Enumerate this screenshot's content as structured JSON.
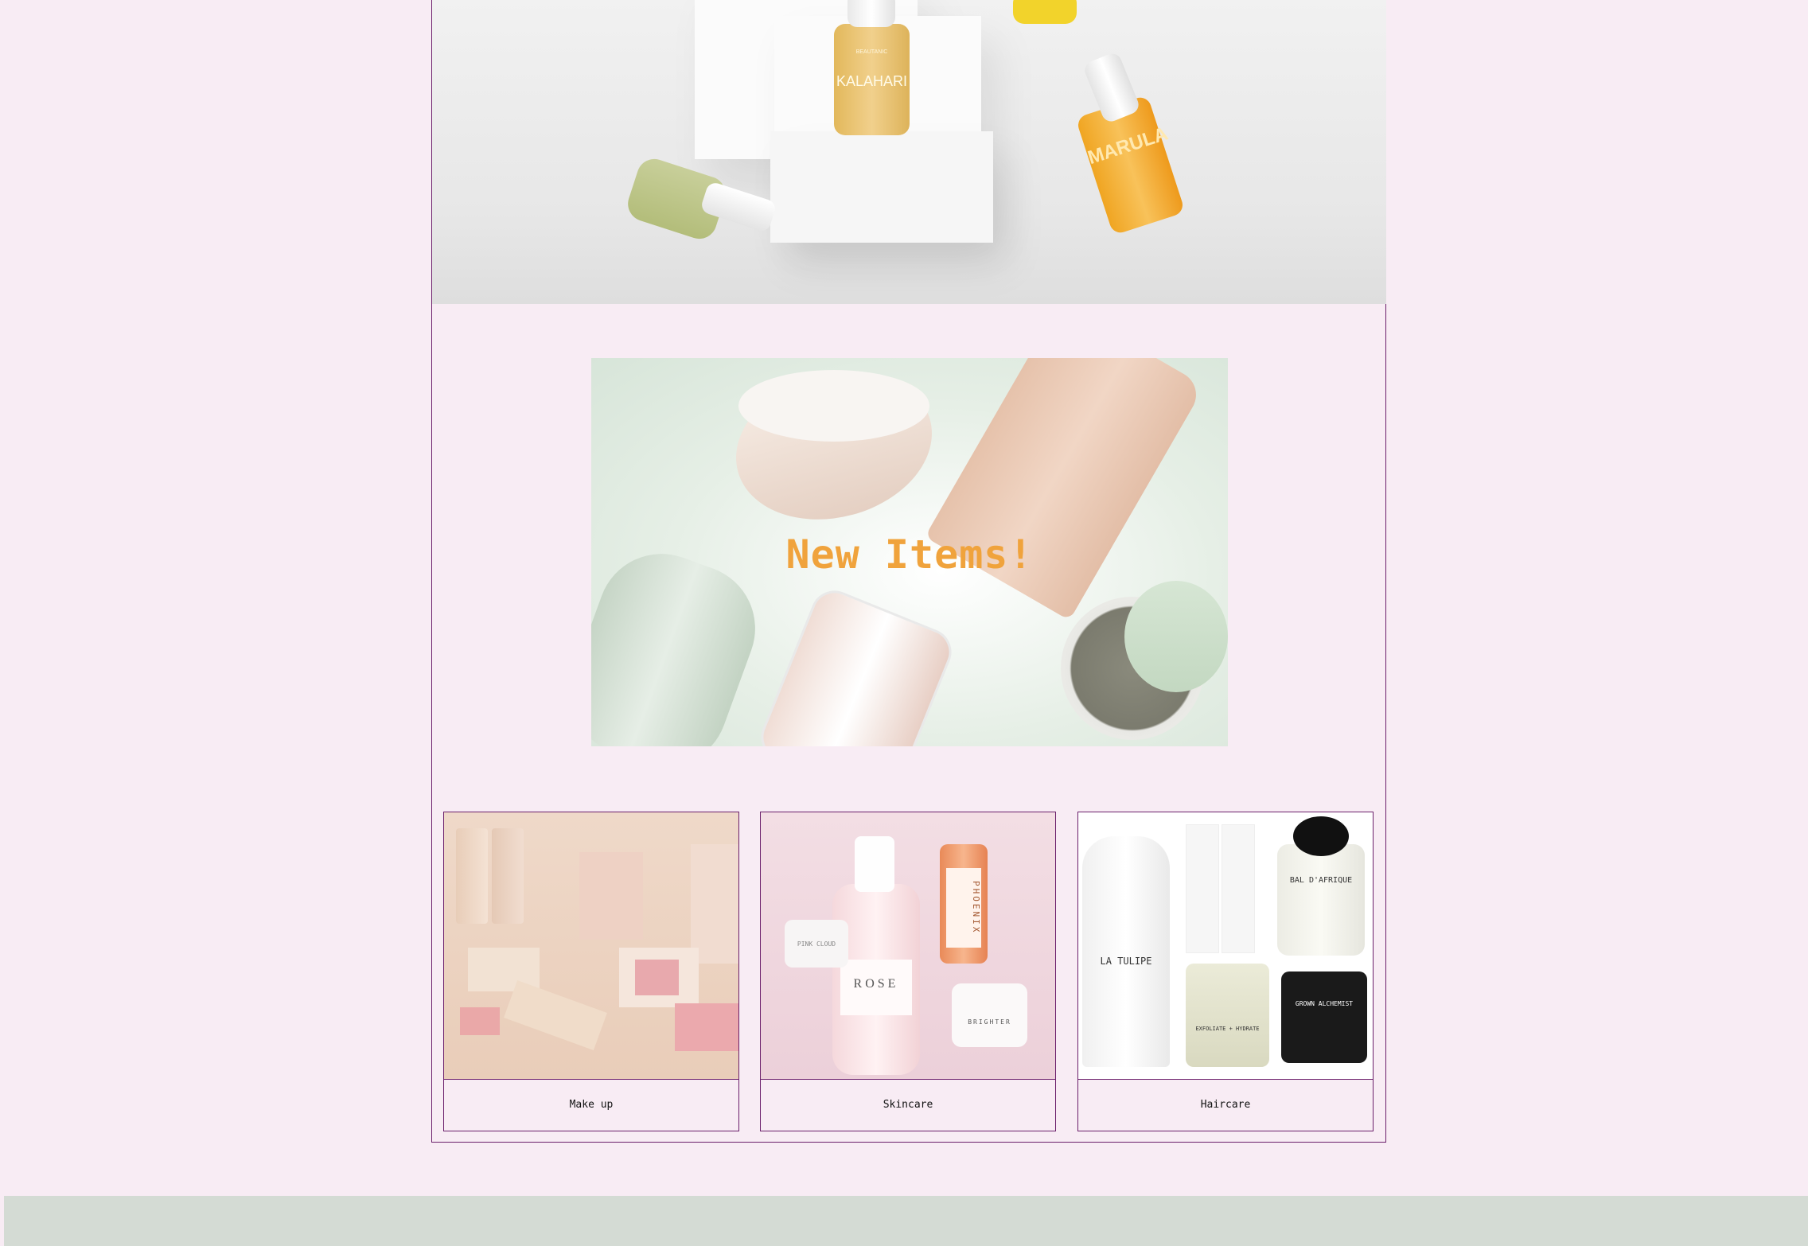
{
  "hero": {
    "bottle_labels": [
      "BEAUTANIC",
      "KALAHARI",
      "MARULA"
    ]
  },
  "banner": {
    "title": "New Items!"
  },
  "categories": [
    {
      "label": "Make up"
    },
    {
      "label": "Skincare"
    },
    {
      "label": "Haircare"
    }
  ],
  "colors": {
    "page_background": "#f8ecf4",
    "border": "#6b1f6b",
    "banner_title": "#f0a33c",
    "footer": "#d4dbd4"
  },
  "skincare_product_labels": [
    "PINK CLOUD",
    "ROSE",
    "PHOENIX",
    "BRIGHTER"
  ],
  "haircare_product_labels": [
    "LA TULIPE",
    "BAL D'AFRIQUE",
    "GROWN ALCHEMIST",
    "EXFOLIATE + HYDRATE"
  ]
}
